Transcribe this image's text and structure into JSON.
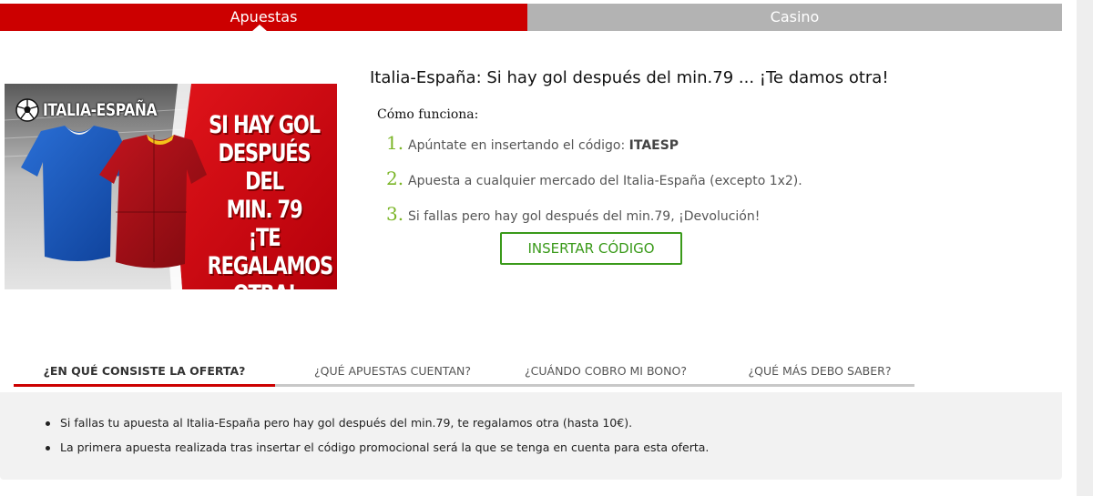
{
  "top_tabs": [
    {
      "label": "Apuestas",
      "active": true
    },
    {
      "label": "Casino",
      "active": false
    }
  ],
  "banner": {
    "icon": "soccer-ball-icon",
    "title": "ITALIA-ESPAÑA",
    "lines": [
      "SI HAY GOL",
      "DESPUÉS DEL",
      "MIN. 79",
      "¡TE REGALAMOS",
      "OTRA!"
    ]
  },
  "promo": {
    "title": "Italia-España: Si hay gol después del min.79 ... ¡Te damos otra!",
    "how_label": "Cómo funciona:",
    "steps": [
      {
        "num": "1.",
        "text": "Apúntate en insertando el código: ",
        "code": "ITAESP"
      },
      {
        "num": "2.",
        "text": "Apuesta a cualquier mercado del Italia-España (excepto 1x2)."
      },
      {
        "num": "3.",
        "text": "Si fallas pero hay gol después del min.79, ¡Devolución!"
      }
    ],
    "button_label": "INSERTAR CÓDIGO"
  },
  "info_tabs": [
    {
      "label": "¿EN QUÉ CONSISTE LA OFERTA?",
      "active": true
    },
    {
      "label": "¿QUÉ APUESTAS CUENTAN?",
      "active": false
    },
    {
      "label": "¿CUÁNDO COBRO MI BONO?",
      "active": false
    },
    {
      "label": "¿QUÉ MÁS DEBO SABER?",
      "active": false
    }
  ],
  "panel": {
    "bullets": [
      "Si fallas tu apuesta al Italia-España pero hay gol después del min.79, te regalamos otra (hasta 10€).",
      "La primera apuesta realizada tras insertar el código promocional será la que se tenga en cuenta para esta oferta."
    ]
  },
  "colors": {
    "brand_red": "#cc0000",
    "tab_grey": "#b3b3b3",
    "accent_green": "#3a9a1a",
    "step_number_green": "#7ab526"
  }
}
